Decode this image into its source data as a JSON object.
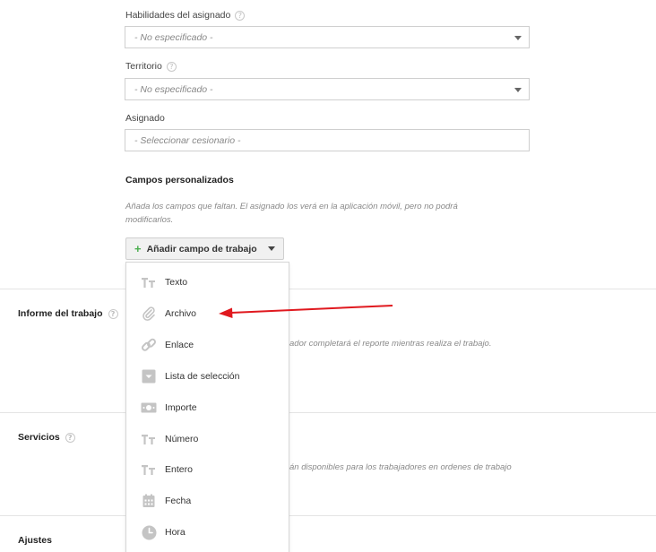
{
  "fields": {
    "skills": {
      "label": "Habilidades del asignado",
      "value": "- No especificado -"
    },
    "territory": {
      "label": "Territorio",
      "value": "- No especificado -"
    },
    "assignee": {
      "label": "Asignado",
      "placeholder": "- Seleccionar cesionario -"
    }
  },
  "custom_fields": {
    "title": "Campos personalizados",
    "hint_line1": "Añada los campos que faltan. El asignado los verá en la aplicación móvil, pero no podrá",
    "hint_line2": "modificarlos.",
    "add_button": "Añadir campo de trabajo"
  },
  "dropdown": {
    "items": [
      {
        "label": "Texto",
        "icon": "text-icon"
      },
      {
        "label": "Archivo",
        "icon": "paperclip-icon"
      },
      {
        "label": "Enlace",
        "icon": "link-icon"
      },
      {
        "label": "Lista de selección",
        "icon": "select-list-icon"
      },
      {
        "label": "Importe",
        "icon": "money-icon"
      },
      {
        "label": "Número",
        "icon": "text-icon"
      },
      {
        "label": "Entero",
        "icon": "text-icon"
      },
      {
        "label": "Fecha",
        "icon": "calendar-icon"
      },
      {
        "label": "Hora",
        "icon": "clock-icon"
      }
    ]
  },
  "sections": {
    "report": {
      "title": "Informe del trabajo",
      "hint": "ador completará el reporte mientras realiza el trabajo."
    },
    "services": {
      "title": "Servicios",
      "hint": "án disponibles para los trabajadores en ordenes de trabajo"
    },
    "settings": {
      "title": "Ajustes"
    }
  },
  "colors": {
    "annotation_arrow": "#e0191f",
    "plus": "#4caf50",
    "icon_gray": "#c4c4c4"
  }
}
